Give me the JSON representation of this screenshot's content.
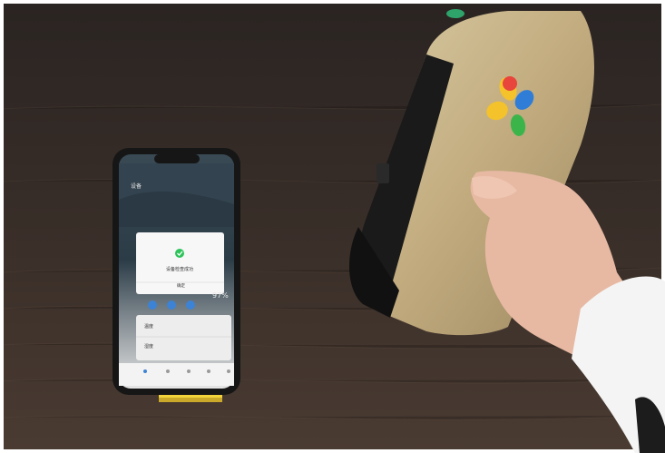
{
  "scene": {
    "description_free": true,
    "phone_screen": {
      "header_title": "设备",
      "dialog_message": "设备检查成功",
      "dialog_button": "确定",
      "battery_reading": "97%",
      "list_items": [
        "温度",
        "湿度"
      ]
    }
  },
  "colors": {
    "table": "#3b2f29",
    "wall": "#2c2624",
    "device_body": "#c8b48a",
    "sleeve": "#f4f4f4",
    "stand": "#f2d33c",
    "success_check": "#2ec35b"
  },
  "icons": [
    "check-circle-icon",
    "flower-logo-icon"
  ]
}
